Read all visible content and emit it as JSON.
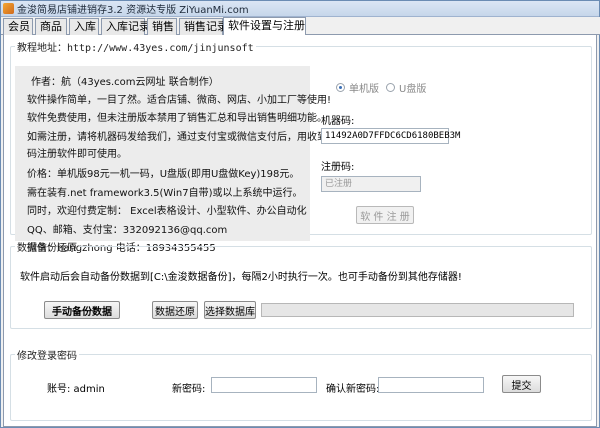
{
  "window": {
    "title": "金浚简易店铺进销存3.2 资源达专版 ZiYuanMi.com"
  },
  "tabs": [
    {
      "label": "会员"
    },
    {
      "label": "商品"
    },
    {
      "label": "入库"
    },
    {
      "label": "入库记录"
    },
    {
      "label": "销售"
    },
    {
      "label": "销售记录"
    },
    {
      "label": "软件设置与注册"
    }
  ],
  "active_tab": "软件设置与注册",
  "tutorial": {
    "legend": "教程地址：http://www.43yes.com/jinjunsoft",
    "lines": [
      "作者：航（43yes.com云网址 联合制作）",
      "软件操作简单，一目了然。适合店铺、微商、网店、小加工厂等使用!",
      "软件免费使用，但未注册版本禁用了销售汇总和导出销售明细功能。",
      "如需注册，请将机器码发给我们，通过支付宝或微信支付后，用收到的注册",
      "码注册软件即可使用。",
      "价格：单机版98元一机一码，U盘版(即用U盘做Key)198元。",
      "需在装有.net framework3.5(Win7自带)或以上系统中运行。",
      "同时，欢迎付费定制： Excel表格设计、小型软件、办公自动化",
      "QQ、邮箱、支付宝：332092136@qq.com",
      "微信：hangzhong  电话：18934355455"
    ]
  },
  "registration": {
    "radio_standalone": "单机版",
    "radio_usb": "U盘版",
    "selected_edition": "单机版",
    "machine_code_label": "机器码:",
    "machine_code_value": "11492A0D7FFDC6CD6180BEB3M",
    "reg_code_label": "注册码:",
    "reg_code_placeholder": "已注册",
    "register_button": "软 件 注 册"
  },
  "backup": {
    "legend": "数据备份还原",
    "description": "软件启动后会自动备份数据到[C:\\金浚数据备份]，每隔2小时执行一次。也可手动备份到其他存储器!",
    "manual_backup_button": "手动备份数据",
    "restore_button": "数据还原",
    "choose_db_button": "选择数据库",
    "progress": 0
  },
  "password": {
    "legend": "修改登录密码",
    "account_label": "账号: admin",
    "new_password_label": "新密码:",
    "confirm_password_label": "确认新密码:",
    "submit_button": "提交"
  }
}
